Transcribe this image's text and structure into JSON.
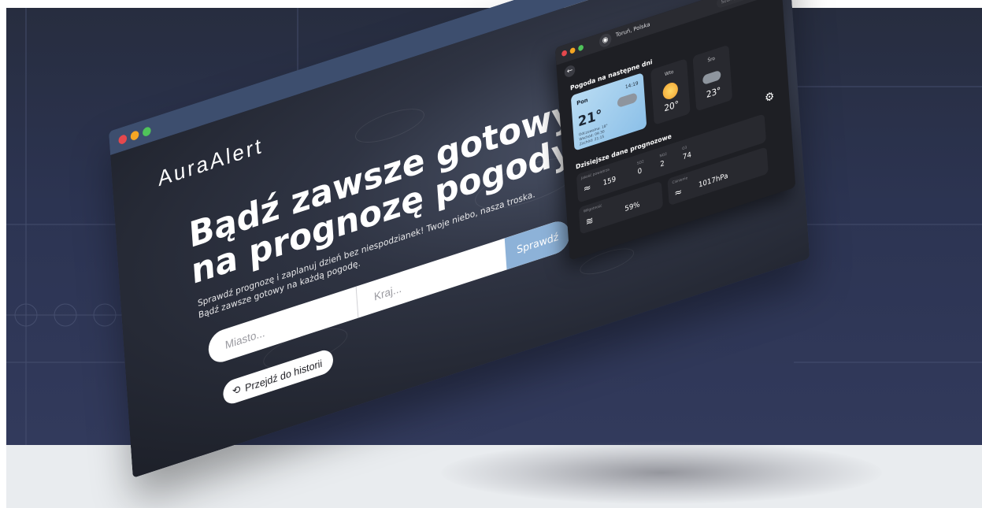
{
  "colors": {
    "accent": "#8db2d8",
    "window_bar": "#3d4e6e",
    "background": "#2c3452"
  },
  "window": {
    "dots": [
      "#e5484d",
      "#f5a623",
      "#4fc35a"
    ]
  },
  "brand": "AuraAlert",
  "hero": {
    "line1": "Bądź zawsze gotowy",
    "line2": "na prognozę pogody"
  },
  "subtitle": {
    "line1": "Sprawdź prognozę i zaplanuj dzień bez niespodzianek! Twoje niebo, nasza troska.",
    "line2": "Bądź zawsze gotowy na każdą pogodę."
  },
  "search": {
    "city_placeholder": "Miasto...",
    "country_placeholder": "Kraj...",
    "button_label": "Sprawdź"
  },
  "history_button": {
    "icon": "history-icon",
    "label": "Przejdź do historii"
  },
  "app_preview": {
    "location": "Toruń, Polska",
    "search_placeholder": "Szukaj...",
    "forecast_title": "Pogoda na następne dni",
    "today": {
      "day": "Pon",
      "time": "14:19",
      "temp": "21°",
      "details": [
        "Odczuwalna: 18°",
        "Wschód: 04:30",
        "Zachód: 21:15"
      ]
    },
    "days": [
      {
        "day": "Wto",
        "temp": "20°",
        "icon": "sun-icon"
      },
      {
        "day": "Śro",
        "temp": "23°",
        "icon": "cloud-icon"
      }
    ],
    "today_title": "Dzisiejsze dane prognozowe",
    "wind": {
      "label": "Jakość powietrza",
      "values": [
        "159",
        "0",
        "2",
        "74"
      ],
      "sublabels": [
        "",
        "SO2",
        "NO2",
        "O3"
      ]
    },
    "pressure": {
      "label": "Ciśnienie",
      "value": "1017hPa"
    },
    "humidity": {
      "label": "Wilgotność",
      "value": "59%"
    }
  }
}
